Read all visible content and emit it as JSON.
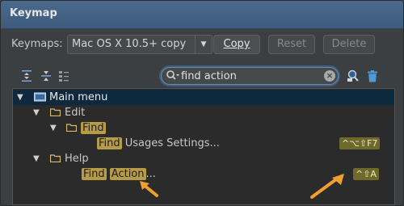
{
  "window": {
    "title": "Keymap"
  },
  "keymaps": {
    "label": "Keymaps:",
    "selected": "Mac OS X 10.5+ copy",
    "buttons": {
      "copy": "Copy",
      "reset": "Reset",
      "delete": "Delete"
    }
  },
  "search": {
    "value": "find action",
    "clear": "×"
  },
  "tree": {
    "root": "Main menu",
    "edit": "Edit",
    "find_group": "Find",
    "usages_prefix": "Find",
    "usages_rest": " Usages Settings...",
    "usages_shortcut": "^⌥⇧F7",
    "help": "Help",
    "action_word1": "Find",
    "action_word2": "Action",
    "action_rest": "...",
    "action_shortcut": "^⇧A"
  },
  "colors": {
    "title_bar": "#3d5b7c",
    "selection": "#0d293e",
    "match_highlight": "#b89b46",
    "shortcut_bg": "#6e6a2b",
    "annotation_arrow": "#f0a030"
  },
  "icons": [
    "expand-all-icon",
    "collapse-all-icon",
    "tree-view-icon",
    "search-icon",
    "find-shortcut-icon",
    "trash-icon",
    "folder-icon",
    "arrow-pointer-icon"
  ]
}
